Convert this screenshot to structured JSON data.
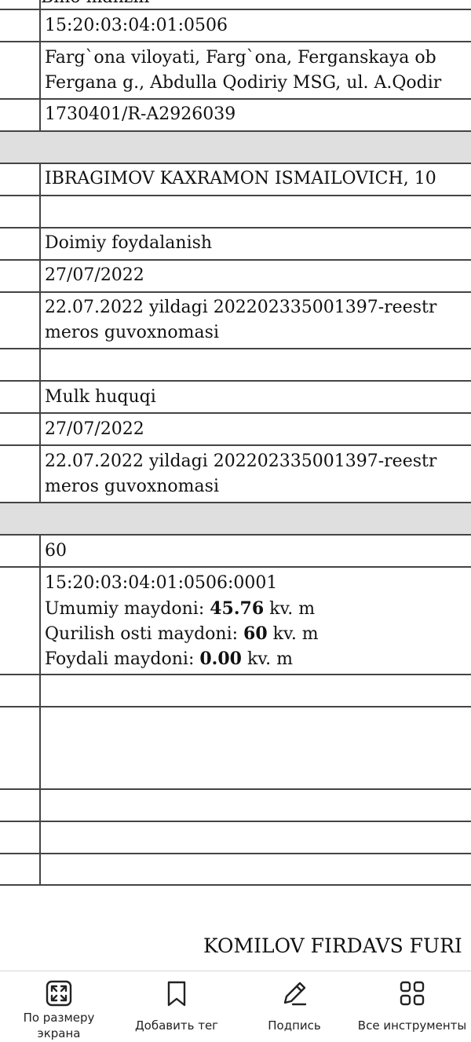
{
  "document": {
    "top_cut_text": "Bino manzili",
    "cadastre_number": "15:20:03:04:01:0506",
    "address_line1": "Farg`ona viloyati, Farg`ona, Ferganskaya ob",
    "address_line2": "Fergana g., Abdulla Qodiriy MSG, ul. A.Qodir",
    "registry_number": "1730401/R-A2926039",
    "owner": "IBRAGIMOV KAXRAMON ISMAILOVICH, 10",
    "right1": {
      "type": "Doimiy foydalanish",
      "date": "27/07/2022",
      "basis_line1": "22.07.2022 yildagi 202202335001397-reestr",
      "basis_line2": "meros guvoxnomasi"
    },
    "right2": {
      "type": "Mulk huquqi",
      "date": "27/07/2022",
      "basis_line1": "22.07.2022 yildagi 202202335001397-reestr",
      "basis_line2": "meros guvoxnomasi"
    },
    "area_value": "60",
    "building": {
      "cadastre": "15:20:03:04:01:0506:0001",
      "total_label": "Umumiy maydoni: ",
      "total_value": "45.76",
      "under_label": "Qurilish osti maydoni: ",
      "under_value": "60",
      "useful_label": "Foydali maydoni: ",
      "useful_value": "0.00",
      "unit": " kv. m"
    },
    "signer": "KOMILOV FIRDAVS FURI"
  },
  "toolbar": {
    "fit_line1": "По размеру",
    "fit_line2": "экрана",
    "add_tag": "Добавить тег",
    "sign": "Подпись",
    "all_tools": "Все инструменты"
  }
}
